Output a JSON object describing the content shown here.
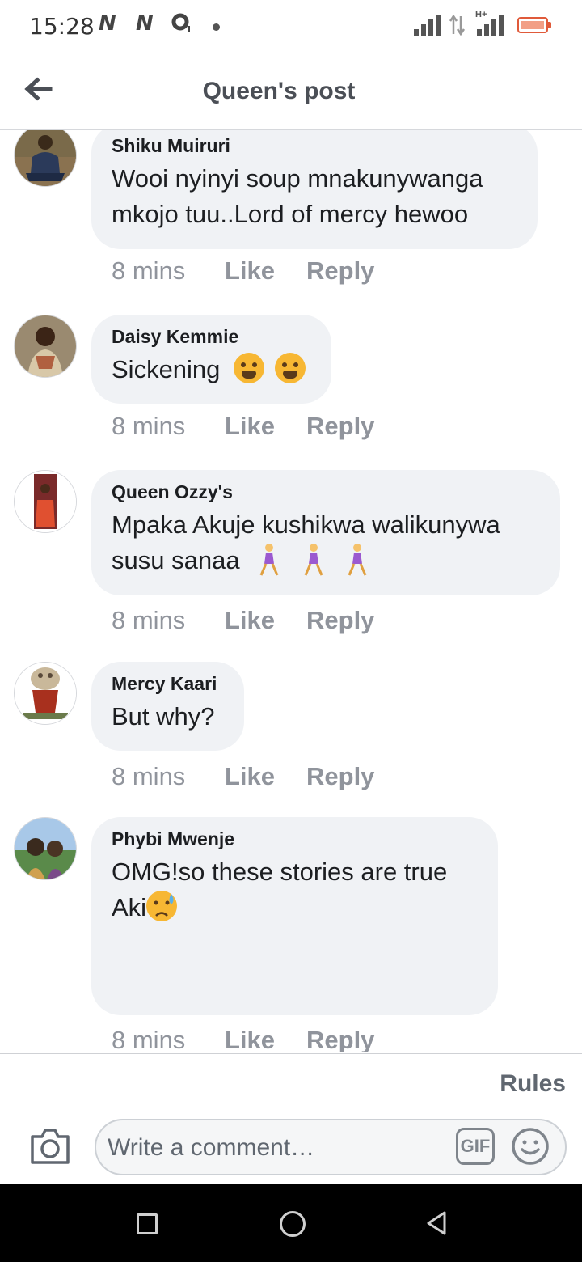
{
  "status_bar": {
    "time": "15:28",
    "notifications": [
      "N",
      "N"
    ],
    "network": "H+",
    "icons": [
      "n-app-icon",
      "n-app-icon",
      "opera-icon",
      "dot-icon",
      "signal-icon",
      "data-arrows-icon",
      "signal-icon",
      "battery-icon"
    ]
  },
  "header": {
    "title": "Queen's post",
    "back_icon": "back-arrow-icon"
  },
  "comments": [
    {
      "author": "Shiku Muiruri",
      "text": "Wooi nyinyi soup mnakunywanga mkojo tuu..Lord of mercy hewoo",
      "time": "8 mins",
      "like": "Like",
      "reply": "Reply"
    },
    {
      "author": "Daisy Kemmie",
      "text": "Sickening",
      "emojis": [
        "anguished-face",
        "anguished-face"
      ],
      "time": "8 mins",
      "like": "Like",
      "reply": "Reply"
    },
    {
      "author": "Queen Ozzy's",
      "text": "Mpaka Akuje kushikwa walikunywa susu sanaa",
      "emojis": [
        "woman-walking",
        "woman-walking",
        "woman-walking"
      ],
      "time": "8 mins",
      "like": "Like",
      "reply": "Reply"
    },
    {
      "author": "Mercy Kaari",
      "text": "But why?",
      "time": "8 mins",
      "like": "Like",
      "reply": "Reply"
    },
    {
      "author": "Phybi Mwenje",
      "text": "OMG!so these stories are true Aki",
      "emojis": [
        "sad-but-relieved-face"
      ],
      "time": "8 mins",
      "like": "Like",
      "reply": "Reply"
    }
  ],
  "composer": {
    "rules_label": "Rules",
    "placeholder": "Write a comment…",
    "gif_label": "GIF",
    "icons": [
      "camera-icon",
      "gif-icon",
      "smile-icon"
    ]
  },
  "nav_bar": {
    "icons": [
      "recent-apps-icon",
      "home-icon",
      "back-icon"
    ]
  },
  "colors": {
    "bubble": "#f0f2f5",
    "meta_text": "#90949c",
    "header_text": "#4b4f56",
    "battery": "#e05a3a"
  }
}
